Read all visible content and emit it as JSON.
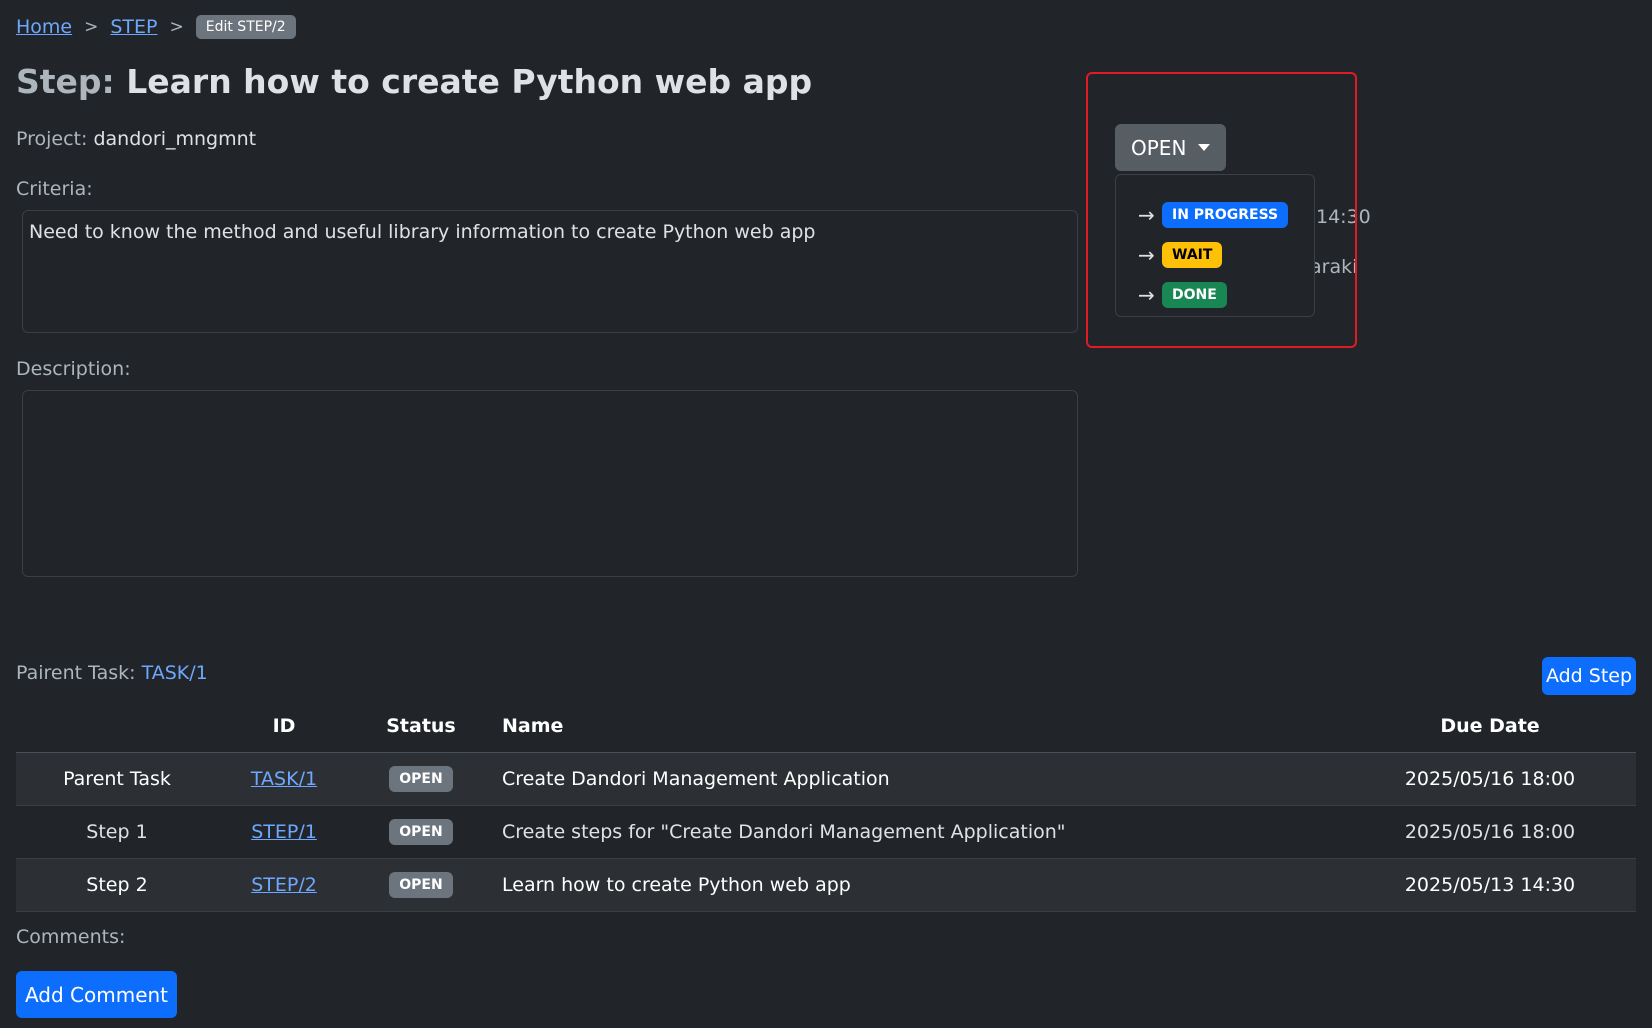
{
  "breadcrumb": {
    "home": "Home",
    "step": "STEP",
    "current": "Edit STEP/2",
    "sep": ">"
  },
  "title": {
    "prefix": "Step:",
    "text": "Learn how to create Python web app"
  },
  "project": {
    "label": "Project:",
    "value": "dandori_mngmnt"
  },
  "criteria": {
    "label": "Criteria:",
    "value": "Need to know the method and useful library information to create Python web app"
  },
  "description": {
    "label": "Description:",
    "value": ""
  },
  "info_right": {
    "due_fragment": "14:30",
    "owner_fragment": "araki"
  },
  "status": {
    "current": "OPEN",
    "options": [
      {
        "arrow": "→",
        "label": "IN PROGRESS",
        "color": "#0d6efd"
      },
      {
        "arrow": "→",
        "label": "WAIT",
        "color": "#ffc107"
      },
      {
        "arrow": "→",
        "label": "DONE",
        "color": "#198754"
      }
    ]
  },
  "parent_task": {
    "label": "Pairent Task:",
    "link": "TASK/1"
  },
  "add_step_label": "Add Step",
  "table": {
    "headers": {
      "type": "",
      "id": "ID",
      "status": "Status",
      "name": "Name",
      "due": "Due Date"
    },
    "rows": [
      {
        "type": "Parent Task",
        "id": "TASK/1",
        "status": "OPEN",
        "name": "Create Dandori Management Application",
        "due": "2025/05/16 18:00"
      },
      {
        "type": "Step 1",
        "id": "STEP/1",
        "status": "OPEN",
        "name": "Create steps for \"Create Dandori Management Application\"",
        "due": "2025/05/16 18:00"
      },
      {
        "type": "Step 2",
        "id": "STEP/2",
        "status": "OPEN",
        "name": "Learn how to create Python web app",
        "due": "2025/05/13 14:30"
      }
    ]
  },
  "comments": {
    "label": "Comments:",
    "add_label": "Add Comment"
  }
}
